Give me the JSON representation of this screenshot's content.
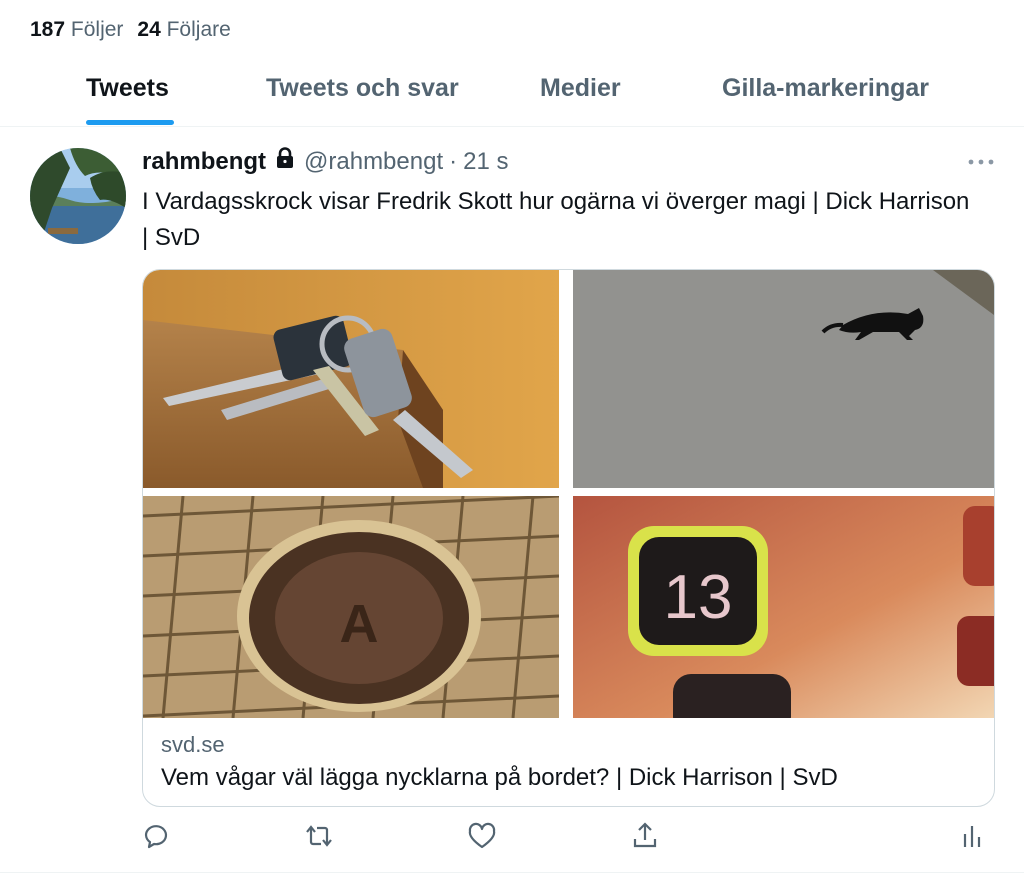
{
  "profile_stats": {
    "following_count": "187",
    "following_label": "Följer",
    "followers_count": "24",
    "followers_label": "Följare"
  },
  "tabs": [
    {
      "label": "Tweets",
      "active": true
    },
    {
      "label": "Tweets och svar",
      "active": false
    },
    {
      "label": "Medier",
      "active": false
    },
    {
      "label": "Gilla-markeringar",
      "active": false
    }
  ],
  "tweet": {
    "display_name": "rahmbengt",
    "protected_icon": "lock-icon",
    "handle": "@rahmbengt",
    "separator": "·",
    "time": "21 s",
    "text": "I Vardagsskrock visar Fredrik Skott hur ogärna vi överger magi | Dick Harrison | SvD",
    "card": {
      "domain": "svd.se",
      "title": "Vem vågar väl lägga nycklarna på bordet? | Dick Harrison | SvD",
      "images": [
        {
          "icon": "keys-on-table-image"
        },
        {
          "icon": "black-cat-crossing-road-image"
        },
        {
          "icon": "manhole-cover-image"
        },
        {
          "icon": "elevator-button-13-image",
          "text": "13"
        }
      ]
    },
    "actions": [
      "reply-icon",
      "retweet-icon",
      "like-icon",
      "share-icon",
      "analytics-icon"
    ]
  },
  "colors": {
    "accent": "#1d9bf0",
    "text_primary": "#0f1419",
    "text_secondary": "#536471",
    "border": "#cfd9de"
  }
}
